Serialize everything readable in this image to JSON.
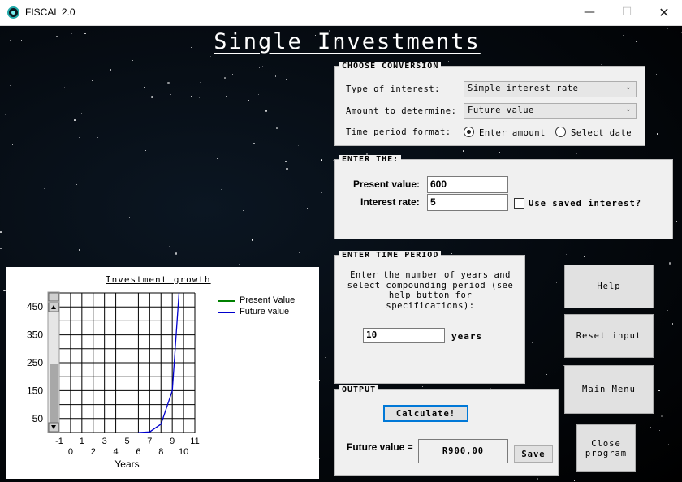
{
  "window": {
    "title": "FISCAL 2.0",
    "minimize": "—",
    "maximize": "☐",
    "close": "✕"
  },
  "page_title": "Single Investments",
  "conversion": {
    "legend": "CHOOSE CONVERSION",
    "type_label": "Type of interest:",
    "type_value": "Simple interest rate",
    "amount_label": "Amount to determine:",
    "amount_value": "Future value",
    "period_label": "Time period format:",
    "radio_enter": "Enter amount",
    "radio_date": "Select date",
    "selected": "enter_amount"
  },
  "enter": {
    "legend": "ENTER THE:",
    "present_label": "Present value:",
    "present_value": "600",
    "rate_label": "Interest rate:",
    "rate_value": "5",
    "saved_label": "Use saved interest?",
    "saved_checked": false
  },
  "time_period": {
    "legend": "ENTER TIME PERIOD",
    "instructions": "Enter the number of years and select compounding period (see help button for specifications):",
    "years_value": "10",
    "years_label": "years"
  },
  "output": {
    "legend": "OUTPUT",
    "calculate_label": "Calculate!",
    "future_label": "Future value =",
    "future_value": "R900,00",
    "save_label": "Save"
  },
  "side_buttons": {
    "help": "Help",
    "reset": "Reset input",
    "main_menu": "Main Menu",
    "close_program": "Close program"
  },
  "colors": {
    "present": "#008000",
    "future": "#0000cc"
  },
  "chart_data": {
    "type": "line",
    "title": "Investment growth",
    "xlabel": "Years",
    "xlim": [
      -1,
      11
    ],
    "ylim": [
      0,
      500
    ],
    "x_ticks_top": [
      "-1",
      "1",
      "3",
      "5",
      "7",
      "9",
      "11"
    ],
    "x_ticks_bottom": [
      "0",
      "2",
      "4",
      "6",
      "8",
      "10"
    ],
    "y_ticks": [
      "450",
      "350",
      "250",
      "150",
      "50"
    ],
    "grid": true,
    "legend_position": "right",
    "series": [
      {
        "name": "Present Value",
        "color": "#008000",
        "x": [],
        "y": []
      },
      {
        "name": "Future value",
        "color": "#0000cc",
        "x": [
          6,
          7,
          8,
          9,
          9.6
        ],
        "y": [
          0,
          2,
          30,
          150,
          500
        ]
      }
    ]
  }
}
